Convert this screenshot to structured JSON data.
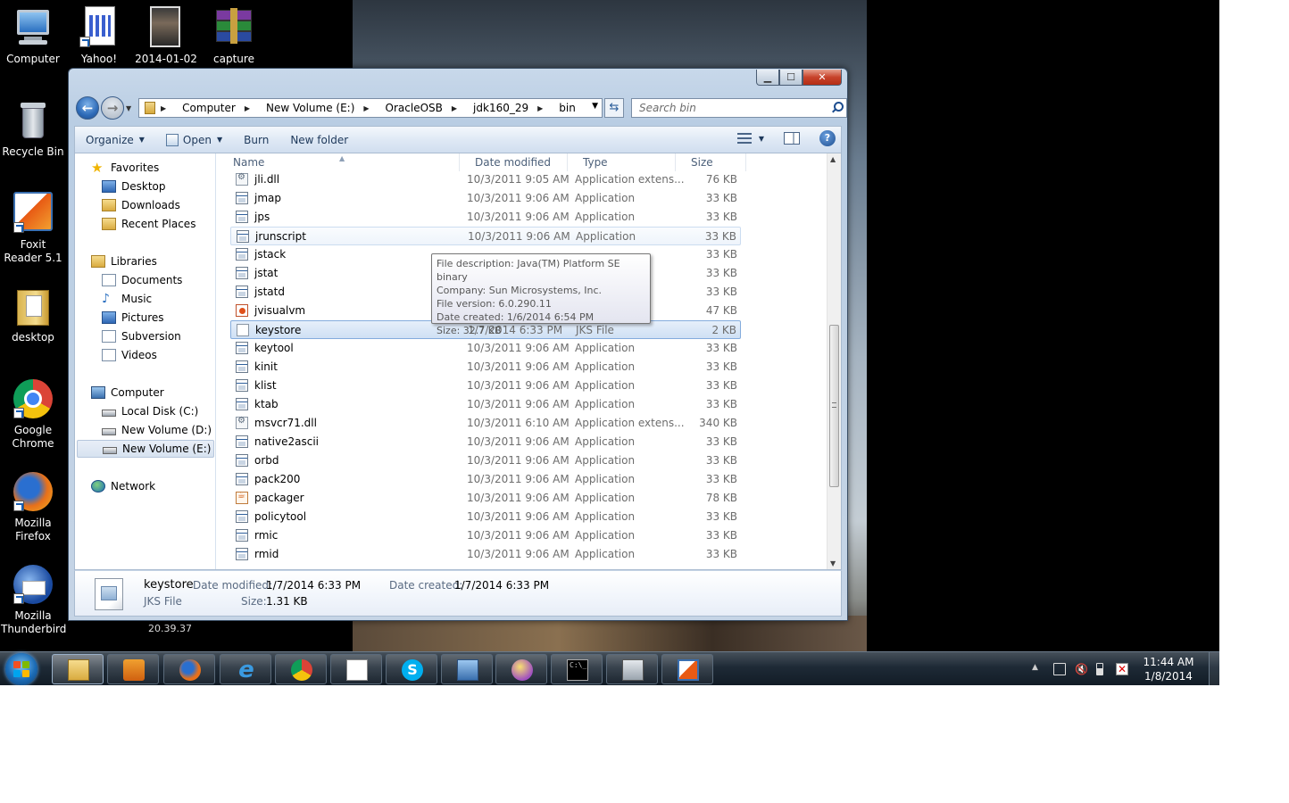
{
  "desktop": {
    "icons": [
      {
        "label": "Computer",
        "icon": "computer-icon"
      },
      {
        "label": "Yahoo!",
        "icon": "web-shortcut-icon"
      },
      {
        "label": "2014-01-02",
        "icon": "photo-icon"
      },
      {
        "label": "capture",
        "icon": "winrar-archive-icon"
      },
      {
        "label": "Recycle Bin",
        "icon": "recycle-bin-icon"
      },
      {
        "label": "Foxit Reader 5.1",
        "icon": "foxit-reader-icon"
      },
      {
        "label": "desktop",
        "icon": "folder-icon"
      },
      {
        "label": "Google Chrome",
        "icon": "chrome-icon"
      },
      {
        "label": "Mozilla Firefox",
        "icon": "firefox-icon"
      },
      {
        "label": "Mozilla Thunderbird",
        "icon": "thunderbird-icon"
      }
    ],
    "gadget_text": "20.39.37"
  },
  "window": {
    "caption_buttons": {
      "minimize": "▁",
      "maximize": "☐",
      "close": "✕"
    },
    "address": {
      "crumbs": [
        "Computer",
        "New Volume (E:)",
        "OracleOSB",
        "jdk160_29",
        "bin"
      ]
    },
    "search": {
      "placeholder": "Search bin"
    },
    "toolbar": {
      "organize": "Organize",
      "open": "Open",
      "burn": "Burn",
      "new_folder": "New folder"
    },
    "nav_pane": {
      "favorites": "Favorites",
      "desktop": "Desktop",
      "downloads": "Downloads",
      "recent_places": "Recent Places",
      "libraries": "Libraries",
      "documents": "Documents",
      "music": "Music",
      "pictures": "Pictures",
      "subversion": "Subversion",
      "videos": "Videos",
      "computer": "Computer",
      "local_disk_c": "Local Disk (C:)",
      "new_volume_d": "New Volume (D:)",
      "new_volume_e": "New Volume (E:)",
      "network": "Network"
    },
    "columns": {
      "name": "Name",
      "date": "Date modified",
      "type": "Type",
      "size": "Size"
    },
    "files": [
      {
        "name": "jli.dll",
        "date": "10/3/2011 9:05 AM",
        "type": "Application extens...",
        "size": "76 KB",
        "icon": "dll-icon"
      },
      {
        "name": "jmap",
        "date": "10/3/2011 9:06 AM",
        "type": "Application",
        "size": "33 KB",
        "icon": "application-icon"
      },
      {
        "name": "jps",
        "date": "10/3/2011 9:06 AM",
        "type": "Application",
        "size": "33 KB",
        "icon": "application-icon"
      },
      {
        "name": "jrunscript",
        "date": "10/3/2011 9:06 AM",
        "type": "Application",
        "size": "33 KB",
        "icon": "application-icon"
      },
      {
        "name": "jstack",
        "date": "",
        "type": "",
        "size": "33 KB",
        "icon": "application-icon"
      },
      {
        "name": "jstat",
        "date": "",
        "type": "",
        "size": "33 KB",
        "icon": "application-icon"
      },
      {
        "name": "jstatd",
        "date": "",
        "type": "",
        "size": "33 KB",
        "icon": "application-icon"
      },
      {
        "name": "jvisualvm",
        "date": "",
        "type": "",
        "size": "47 KB",
        "icon": "visualvm-icon"
      },
      {
        "name": "keystore",
        "date": "1/7/2014 6:33 PM",
        "type": "JKS File",
        "size": "2 KB",
        "icon": "jks-file-icon"
      },
      {
        "name": "keytool",
        "date": "10/3/2011 9:06 AM",
        "type": "Application",
        "size": "33 KB",
        "icon": "application-icon"
      },
      {
        "name": "kinit",
        "date": "10/3/2011 9:06 AM",
        "type": "Application",
        "size": "33 KB",
        "icon": "application-icon"
      },
      {
        "name": "klist",
        "date": "10/3/2011 9:06 AM",
        "type": "Application",
        "size": "33 KB",
        "icon": "application-icon"
      },
      {
        "name": "ktab",
        "date": "10/3/2011 9:06 AM",
        "type": "Application",
        "size": "33 KB",
        "icon": "application-icon"
      },
      {
        "name": "msvcr71.dll",
        "date": "10/3/2011 6:10 AM",
        "type": "Application extens...",
        "size": "340 KB",
        "icon": "dll-icon"
      },
      {
        "name": "native2ascii",
        "date": "10/3/2011 9:06 AM",
        "type": "Application",
        "size": "33 KB",
        "icon": "application-icon"
      },
      {
        "name": "orbd",
        "date": "10/3/2011 9:06 AM",
        "type": "Application",
        "size": "33 KB",
        "icon": "application-icon"
      },
      {
        "name": "pack200",
        "date": "10/3/2011 9:06 AM",
        "type": "Application",
        "size": "33 KB",
        "icon": "application-icon"
      },
      {
        "name": "packager",
        "date": "10/3/2011 9:06 AM",
        "type": "Application",
        "size": "78 KB",
        "icon": "java-app-icon"
      },
      {
        "name": "policytool",
        "date": "10/3/2011 9:06 AM",
        "type": "Application",
        "size": "33 KB",
        "icon": "application-icon"
      },
      {
        "name": "rmic",
        "date": "10/3/2011 9:06 AM",
        "type": "Application",
        "size": "33 KB",
        "icon": "application-icon"
      },
      {
        "name": "rmid",
        "date": "10/3/2011 9:06 AM",
        "type": "Application",
        "size": "33 KB",
        "icon": "application-icon"
      }
    ],
    "tooltip": {
      "line1": "File description: Java(TM) Platform SE binary",
      "line2": "Company: Sun Microsystems, Inc.",
      "line3": "File version: 6.0.290.11",
      "line4": "Date created: 1/6/2014 6:54 PM",
      "line5": "Size: 32.7 KB"
    },
    "details": {
      "name": "keystore",
      "type": "JKS File",
      "date_modified_label": "Date modified:",
      "date_modified": "1/7/2014 6:33 PM",
      "size_label": "Size:",
      "size": "1.31 KB",
      "date_created_label": "Date created:",
      "date_created": "1/7/2014 6:33 PM"
    }
  },
  "taskbar": {
    "pinned": [
      "windows-explorer-icon",
      "media-player-icon",
      "firefox-icon",
      "internet-explorer-icon",
      "chrome-icon",
      "notepad-icon",
      "skype-icon",
      "network-monitor-icon",
      "yahoo-messenger-icon",
      "command-prompt-icon",
      "file-manager-icon",
      "foxit-reader-icon"
    ],
    "clock": {
      "time": "11:44 AM",
      "date": "1/8/2014"
    }
  },
  "colors": {
    "accent": "#1d4d8f",
    "selection": "#cfe0f4",
    "close": "#c7432b"
  }
}
